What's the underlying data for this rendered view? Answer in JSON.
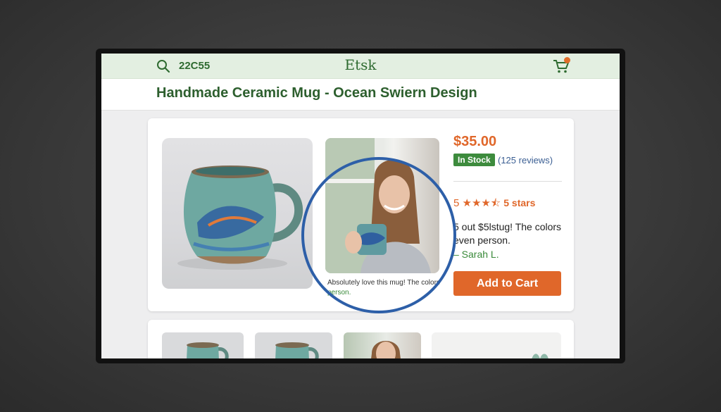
{
  "header": {
    "search_text": "22C55",
    "brand": "Etsk",
    "cart_icon": "cart-icon"
  },
  "product": {
    "title": "Handmade Ceramic Mug - Ocean Swiern Design",
    "price": "$35.00",
    "stock_label": "In Stock",
    "reviews_link": "(125 reviews)",
    "rating_prefix": "5",
    "rating_label": "5 stars",
    "rating_value": 4.5,
    "quote": "5 out $5lstug! The colors even person.",
    "quote_author": "– Sarah L.",
    "add_to_cart_label": "Add to Cart"
  },
  "review_photo": {
    "caption_line1": "Absolutely love this mug! The colors",
    "caption_line2": "person."
  },
  "colors": {
    "brand_green": "#2f6b31",
    "accent_orange": "#e0672a",
    "stock_green": "#3d8b3d",
    "link_blue": "#3b5f93",
    "annotation_ring": "#2d5fa8"
  }
}
